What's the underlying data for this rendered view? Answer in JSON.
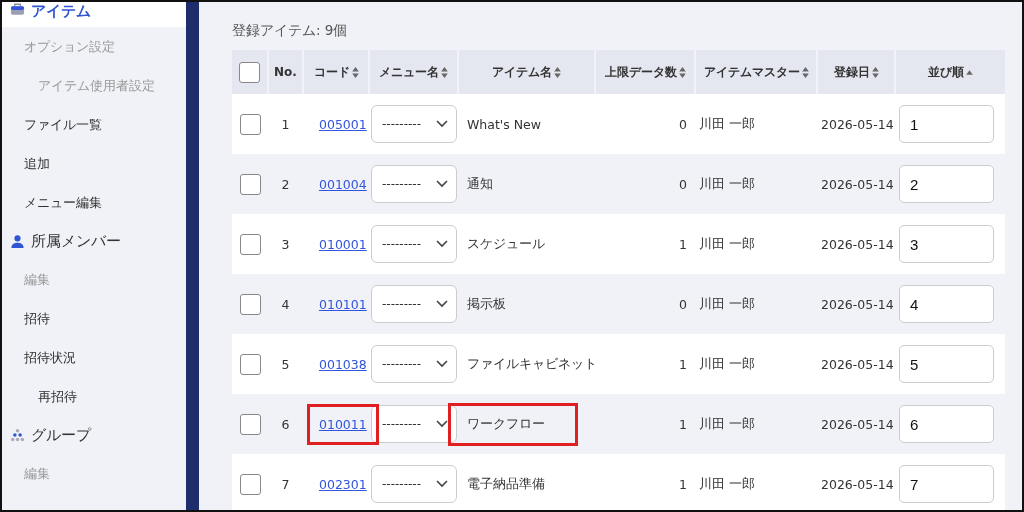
{
  "sidebar": {
    "items": [
      {
        "kind": "section",
        "label": "アイテム",
        "selected": true,
        "children": [
          {
            "kind": "item",
            "label": "オプション設定",
            "disabled": true,
            "children": [
              {
                "kind": "item",
                "label": "アイテム使用者設定",
                "disabled": true
              }
            ]
          },
          {
            "kind": "item",
            "label": "ファイル一覧",
            "disabled": false
          },
          {
            "kind": "item",
            "label": "追加",
            "disabled": false
          },
          {
            "kind": "item",
            "label": "メニュー編集",
            "disabled": false
          }
        ]
      },
      {
        "kind": "section",
        "label": "所属メンバー",
        "selected": false,
        "children": [
          {
            "kind": "item",
            "label": "編集",
            "disabled": true
          },
          {
            "kind": "item",
            "label": "招待",
            "disabled": false
          },
          {
            "kind": "item",
            "label": "招待状況",
            "disabled": false,
            "children": [
              {
                "kind": "item",
                "label": "再招待",
                "disabled": false
              }
            ]
          }
        ]
      },
      {
        "kind": "section",
        "label": "グループ",
        "selected": false,
        "children": [
          {
            "kind": "item",
            "label": "編集",
            "disabled": true
          }
        ]
      }
    ]
  },
  "summary": "登録アイテム: 9個",
  "table": {
    "columns": [
      {
        "kind": "checkbox",
        "checked": false
      },
      {
        "kind": "text",
        "label": "No.",
        "sortable": false,
        "sorted": false
      },
      {
        "kind": "text",
        "label": "コード",
        "sortable": true,
        "sorted": false
      },
      {
        "kind": "text",
        "label": "メニュー名",
        "sortable": true,
        "sorted": false
      },
      {
        "kind": "text",
        "label": "アイテム名",
        "sortable": true,
        "sorted": false
      },
      {
        "kind": "text",
        "label": "上限データ数",
        "sortable": true,
        "sorted": false
      },
      {
        "kind": "text",
        "label": "アイテムマスター",
        "sortable": true,
        "sorted": false
      },
      {
        "kind": "text",
        "label": "登録日",
        "sortable": true,
        "sorted": false
      },
      {
        "kind": "text",
        "label": "並び順",
        "sortable": true,
        "sorted": true
      }
    ],
    "rows": [
      {
        "checked": false,
        "no": "1",
        "code": "005001",
        "menu": "---------",
        "name": "What's New",
        "limit": "0",
        "master": "川田 一郎",
        "date": "2026-05-14",
        "order": "1",
        "highlighted": false
      },
      {
        "checked": false,
        "no": "2",
        "code": "001004",
        "menu": "---------",
        "name": "通知",
        "limit": "0",
        "master": "川田 一郎",
        "date": "2026-05-14",
        "order": "2",
        "highlighted": false
      },
      {
        "checked": false,
        "no": "3",
        "code": "010001",
        "menu": "---------",
        "name": "スケジュール",
        "limit": "1",
        "master": "川田 一郎",
        "date": "2026-05-14",
        "order": "3",
        "highlighted": false
      },
      {
        "checked": false,
        "no": "4",
        "code": "010101",
        "menu": "---------",
        "name": "掲示板",
        "limit": "0",
        "master": "川田 一郎",
        "date": "2026-05-14",
        "order": "4",
        "highlighted": false
      },
      {
        "checked": false,
        "no": "5",
        "code": "001038",
        "menu": "---------",
        "name": "ファイルキャビネット",
        "limit": "1",
        "master": "川田 一郎",
        "date": "2026-05-14",
        "order": "5",
        "highlighted": false
      },
      {
        "checked": false,
        "no": "6",
        "code": "010011",
        "menu": "---------",
        "name": "ワークフロー",
        "limit": "1",
        "master": "川田 一郎",
        "date": "2026-05-14",
        "order": "6",
        "highlighted": true
      },
      {
        "checked": false,
        "no": "7",
        "code": "002301",
        "menu": "---------",
        "name": "電子納品準備",
        "limit": "1",
        "master": "川田 一郎",
        "date": "2026-05-14",
        "order": "7",
        "highlighted": false
      }
    ]
  }
}
